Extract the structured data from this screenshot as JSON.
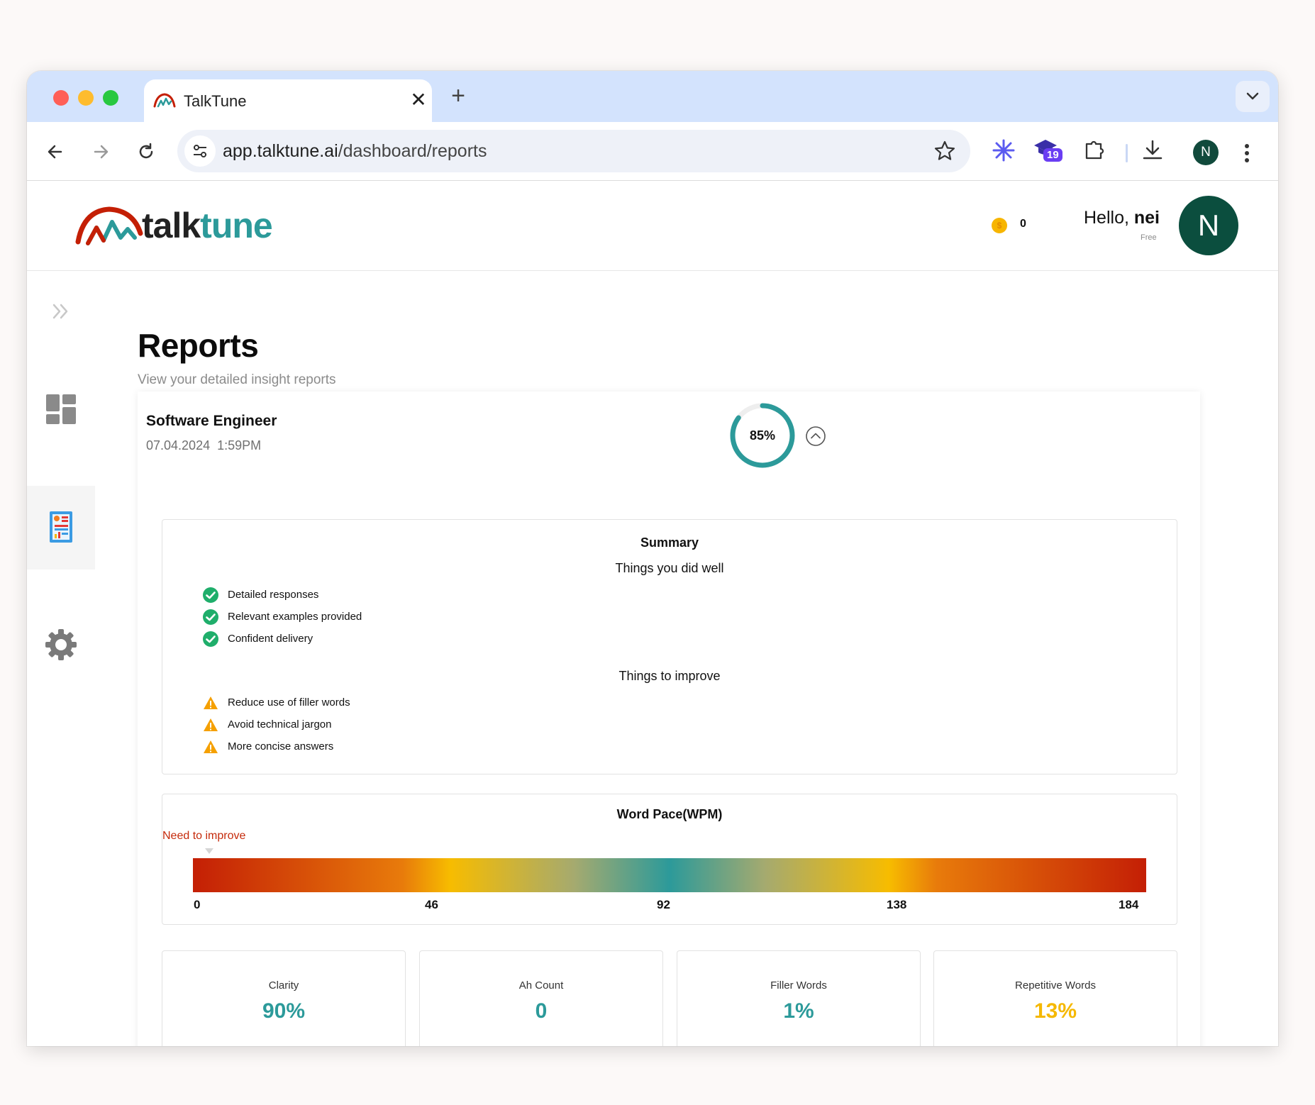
{
  "browser": {
    "tab_title": "TalkTune",
    "tab_close": "✕",
    "new_tab": "+",
    "url_host": "app.talktune.ai",
    "url_path": "/dashboard/reports",
    "extension_badge": "19",
    "profile_initial": "N"
  },
  "header": {
    "logo_talk": "talk",
    "logo_tune": "tune",
    "coin_count": "0",
    "greeting": "Hello,",
    "username": "nei",
    "plan": "Free",
    "avatar_initial": "N"
  },
  "page": {
    "title": "Reports",
    "subtitle": "View your detailed insight reports"
  },
  "report": {
    "role": "Software Engineer",
    "date": "07.04.2024",
    "time": "1:59PM",
    "score_label": "85%",
    "score_fraction": 0.85,
    "summary": {
      "title": "Summary",
      "did_well_title": "Things you did well",
      "did_well": [
        "Detailed responses",
        "Relevant examples provided",
        "Confident delivery"
      ],
      "improve_title": "Things to improve",
      "improve": [
        "Reduce use of filler words",
        "Avoid technical jargon",
        "More concise answers"
      ]
    },
    "word_pace": {
      "title": "Word Pace(WPM)",
      "status": "Need to improve",
      "ticks": [
        "0",
        "46",
        "92",
        "138",
        "184"
      ]
    },
    "metrics": [
      {
        "label": "Clarity",
        "value": "90%",
        "color": "#2c9a9a"
      },
      {
        "label": "Ah Count",
        "value": "0",
        "color": "#2c9a9a"
      },
      {
        "label": "Filler Words",
        "value": "1%",
        "color": "#2c9a9a"
      },
      {
        "label": "Repetitive Words",
        "value": "13%",
        "color": "#f5b800"
      }
    ]
  },
  "colors": {
    "accent": "#2c9a9a",
    "brand_red": "#c41f05",
    "warning": "#f5a000",
    "success": "#1fae6b",
    "avatar": "#0b4e3e"
  }
}
